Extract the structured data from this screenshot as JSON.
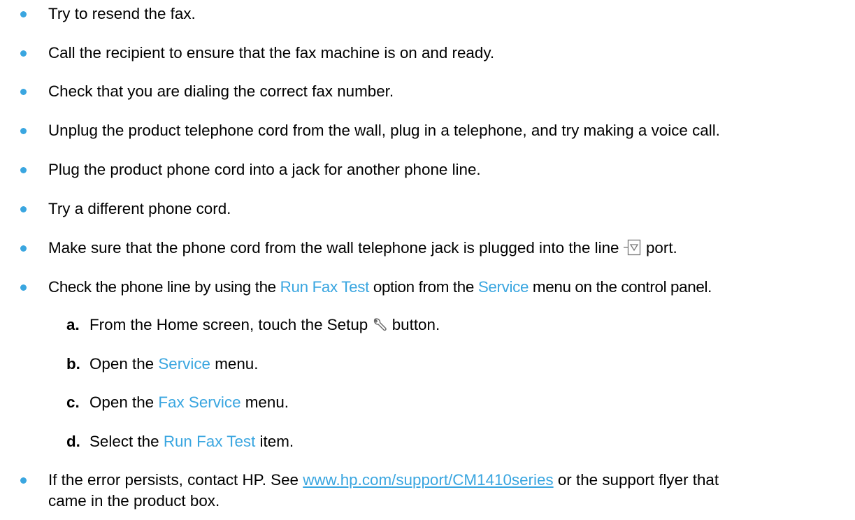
{
  "colors": {
    "bullet": "#3aa6e0",
    "ui_term": "#3aa6e0",
    "link": "#3aa6e0"
  },
  "bullets": [
    "Try to resend the fax.",
    "Call the recipient to ensure that the fax machine is on and ready.",
    "Check that you are dialing the correct fax number.",
    "Unplug the product telephone cord from the wall, plug in a telephone, and try making a voice call.",
    "Plug the product phone cord into a jack for another phone line.",
    "Try a different phone cord."
  ],
  "line_port": {
    "before": "Make sure that the phone cord from the wall telephone jack is plugged into the line ",
    "icon": "line-port-icon",
    "after": " port."
  },
  "fax_test": {
    "t1": "Check the phone line by using the ",
    "ui1": "Run Fax Test",
    "t2": " option from the ",
    "ui2": "Service",
    "t3": " menu on the control panel."
  },
  "steps": [
    {
      "letter": "a.",
      "before": "From the Home screen, touch the Setup ",
      "icon": "wrench-icon",
      "after": " button."
    },
    {
      "letter": "b.",
      "before": "Open the ",
      "ui": "Service",
      "after": " menu."
    },
    {
      "letter": "c.",
      "before": "Open the ",
      "ui": "Fax Service",
      "after": " menu."
    },
    {
      "letter": "d.",
      "before": "Select the ",
      "ui": "Run Fax Test",
      "after": " item."
    }
  ],
  "contact": {
    "before": "If the error persists, contact HP. See ",
    "link": "www.hp.com/support/CM1410series",
    "after_line1": " or the support flyer that",
    "line2": "came in the product box."
  }
}
